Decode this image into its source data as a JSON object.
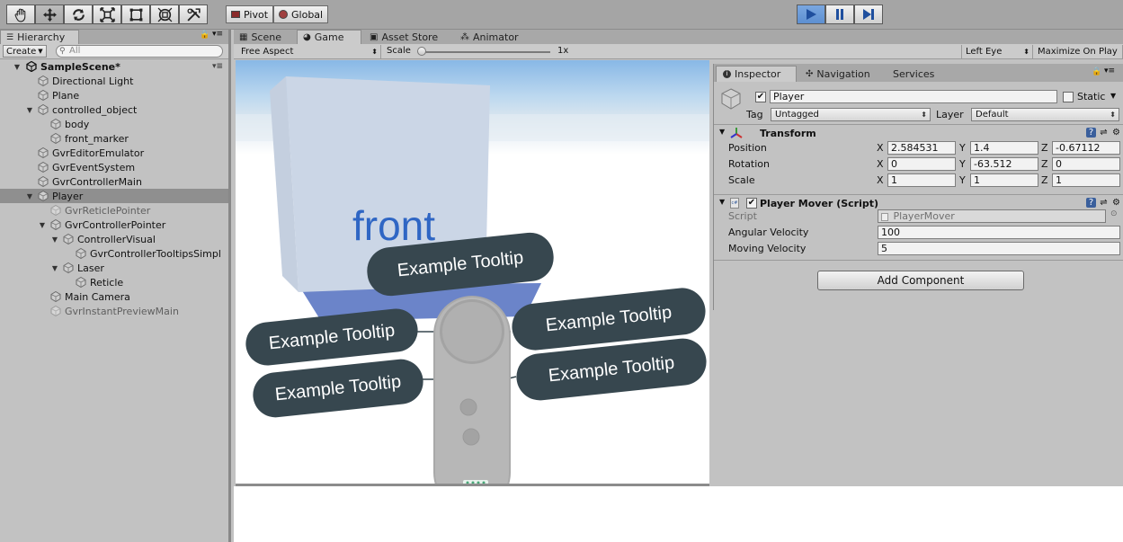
{
  "toolbar": {
    "tools": [
      {
        "name": "hand-tool",
        "icon": "hand-icon"
      },
      {
        "name": "move-tool",
        "icon": "move-arrows-icon"
      },
      {
        "name": "rotate-tool",
        "icon": "rotate-icon"
      },
      {
        "name": "scale-tool",
        "icon": "scale-icon"
      },
      {
        "name": "rect-tool",
        "icon": "rect-icon"
      },
      {
        "name": "transform-tool",
        "icon": "transform-icon"
      },
      {
        "name": "custom-tool",
        "icon": "custom-tool-icon"
      }
    ],
    "pivot_label": "Pivot",
    "global_label": "Global"
  },
  "hierarchy": {
    "tab_label": "Hierarchy",
    "create_label": "Create",
    "search_placeholder": "All",
    "scene_name": "SampleScene*",
    "items": [
      {
        "label": "Directional Light",
        "depth": 1,
        "expand": "",
        "dim": false,
        "selected": false
      },
      {
        "label": "Plane",
        "depth": 1,
        "expand": "",
        "dim": false,
        "selected": false
      },
      {
        "label": "controlled_object",
        "depth": 1,
        "expand": "▼",
        "dim": false,
        "selected": false
      },
      {
        "label": "body",
        "depth": 2,
        "expand": "",
        "dim": false,
        "selected": false
      },
      {
        "label": "front_marker",
        "depth": 2,
        "expand": "",
        "dim": false,
        "selected": false
      },
      {
        "label": "GvrEditorEmulator",
        "depth": 1,
        "expand": "",
        "dim": false,
        "selected": false
      },
      {
        "label": "GvrEventSystem",
        "depth": 1,
        "expand": "",
        "dim": false,
        "selected": false
      },
      {
        "label": "GvrControllerMain",
        "depth": 1,
        "expand": "",
        "dim": false,
        "selected": false
      },
      {
        "label": "Player",
        "depth": 1,
        "expand": "▼",
        "dim": false,
        "selected": true
      },
      {
        "label": "GvrReticlePointer",
        "depth": 2,
        "expand": "",
        "dim": true,
        "selected": false
      },
      {
        "label": "GvrControllerPointer",
        "depth": 2,
        "expand": "▼",
        "dim": false,
        "selected": false
      },
      {
        "label": "ControllerVisual",
        "depth": 3,
        "expand": "▼",
        "dim": false,
        "selected": false
      },
      {
        "label": "GvrControllerTooltipsSimpl",
        "depth": 4,
        "expand": "",
        "dim": false,
        "selected": false
      },
      {
        "label": "Laser",
        "depth": 3,
        "expand": "▼",
        "dim": false,
        "selected": false
      },
      {
        "label": "Reticle",
        "depth": 4,
        "expand": "",
        "dim": false,
        "selected": false
      },
      {
        "label": "Main Camera",
        "depth": 2,
        "expand": "",
        "dim": false,
        "selected": false
      },
      {
        "label": "GvrInstantPreviewMain",
        "depth": 2,
        "expand": "",
        "dim": true,
        "selected": false
      }
    ]
  },
  "game_tabs": [
    {
      "label": "Scene",
      "icon": "scene-grid-icon",
      "active": false
    },
    {
      "label": "Game",
      "icon": "game-pacman-icon",
      "active": true
    },
    {
      "label": "Asset Store",
      "icon": "store-bag-icon",
      "active": false
    },
    {
      "label": "Animator",
      "icon": "animator-icon",
      "active": false
    }
  ],
  "game_bar": {
    "aspect": "Free Aspect",
    "scale_label": "Scale",
    "scale_value": "1x",
    "eye": "Left Eye",
    "maximize": "Maximize On Play"
  },
  "scene_text": {
    "cube_label": "front",
    "tooltips": [
      "Example Tooltip",
      "Example Tooltip",
      "Example Tooltip",
      "Example Tooltip",
      "Example Tooltip"
    ]
  },
  "inspector": {
    "tabs": [
      {
        "label": "Inspector",
        "icon": "info-icon"
      },
      {
        "label": "Navigation",
        "icon": "navigation-icon"
      },
      {
        "label": "Services",
        "icon": ""
      }
    ],
    "object_name": "Player",
    "static_label": "Static",
    "tag_label": "Tag",
    "tag_value": "Untagged",
    "layer_label": "Layer",
    "layer_value": "Default",
    "transform": {
      "title": "Transform",
      "rows": [
        {
          "label": "Position",
          "x": "2.584531",
          "y": "1.4",
          "z": "-0.67112"
        },
        {
          "label": "Rotation",
          "x": "0",
          "y": "-63.512",
          "z": "0"
        },
        {
          "label": "Scale",
          "x": "1",
          "y": "1",
          "z": "1"
        }
      ]
    },
    "player_mover": {
      "title": "Player Mover (Script)",
      "script_label": "Script",
      "script_value": "PlayerMover",
      "angular_label": "Angular Velocity",
      "angular_value": "100",
      "moving_label": "Moving Velocity",
      "moving_value": "5"
    },
    "add_component": "Add Component"
  }
}
